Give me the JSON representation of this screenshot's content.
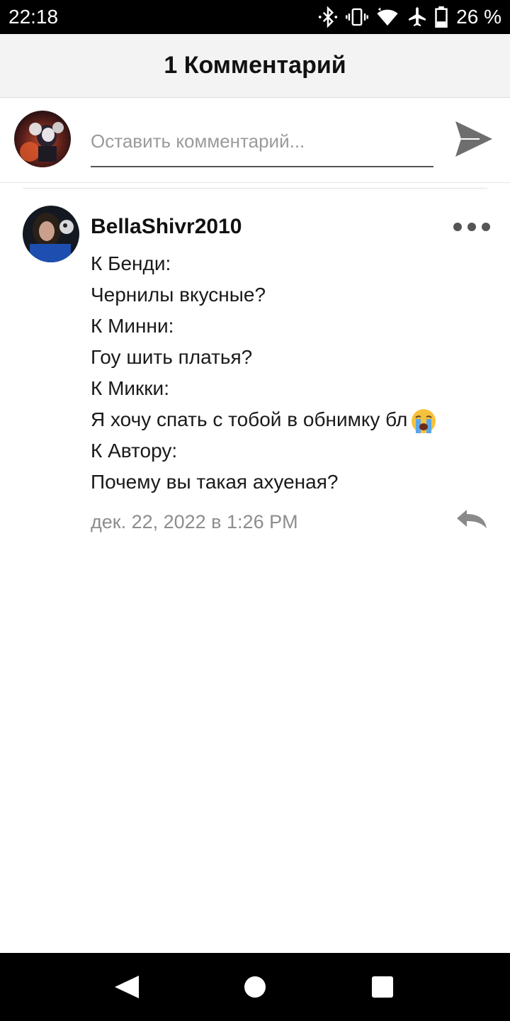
{
  "status_bar": {
    "time": "22:18",
    "battery_percent": "26 %",
    "icons": [
      "bluetooth-icon",
      "vibrate-icon",
      "wifi-icon",
      "airplane-icon",
      "battery-icon"
    ]
  },
  "header": {
    "title": "1 Комментарий"
  },
  "composer": {
    "placeholder": "Оставить комментарий...",
    "value": "",
    "send_icon": "send-icon"
  },
  "comments": [
    {
      "author": "BellaShivr2010",
      "lines": [
        "К Бенди:",
        "Чернилы вкусные?",
        "К Минни:",
        "Гоу шить платья?",
        "К Микки:",
        "Я хочу спать с тобой в обнимку бл",
        "К Автору:",
        "Почему вы такая ахуеная?"
      ],
      "emoji_after_line_6": "loudly-crying-face-emoji",
      "date": "дек. 22, 2022 в 1:26 PM",
      "actions": [
        "more-icon",
        "reply-icon"
      ]
    }
  ],
  "colors": {
    "header_bg": "#f3f3f3",
    "placeholder": "#9a9a9a",
    "date_text": "#8d8d8d",
    "icon_gray": "#6e6e6e"
  }
}
